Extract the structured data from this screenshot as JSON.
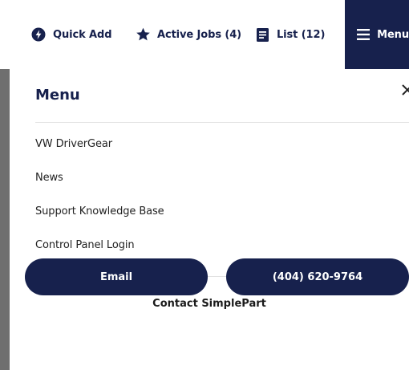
{
  "toolbar": {
    "quick_add": {
      "label": "Quick Add",
      "icon": "bolt-circle-icon"
    },
    "active_jobs": {
      "label": "Active Jobs (4)",
      "icon": "star-icon"
    },
    "list": {
      "label": "List (12)",
      "icon": "list-document-icon"
    },
    "menu": {
      "label": "Menu",
      "icon": "hamburger-icon"
    }
  },
  "menu_panel": {
    "title": "Menu",
    "items": [
      {
        "label": "VW DriverGear"
      },
      {
        "label": "News"
      },
      {
        "label": "Support Knowledge Base"
      },
      {
        "label": "Control Panel Login"
      }
    ],
    "contact_heading": "Contact SimplePart",
    "email_button": "Email",
    "phone_button": "(404) 620-9764"
  },
  "colors": {
    "brand_navy": "#17214d",
    "text": "#222222",
    "divider": "#e2e2e2"
  }
}
